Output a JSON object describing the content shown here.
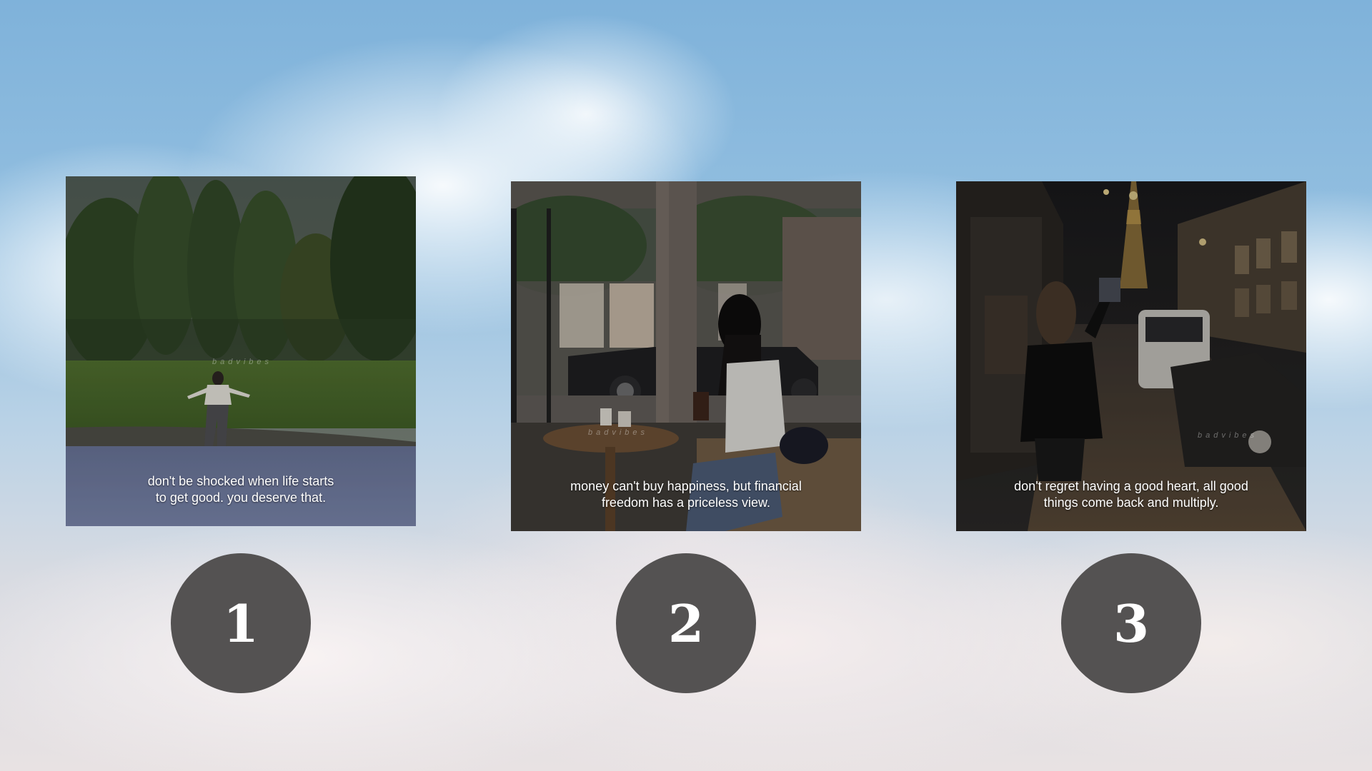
{
  "cards": [
    {
      "number": "1",
      "caption_lines": [
        "don't be shocked when life starts",
        "to get good. you deserve that."
      ],
      "watermark": "badvibes"
    },
    {
      "number": "2",
      "caption_lines": [
        "money can't buy happiness, but financial",
        "freedom has a priceless view."
      ],
      "watermark": "badvibes"
    },
    {
      "number": "3",
      "caption_lines": [
        "don't regret having a good heart, all good",
        "things come back and multiply."
      ],
      "watermark": "badvibes"
    }
  ],
  "colors": {
    "badge_bg": "#545252",
    "caption_text": "#ffffff"
  }
}
